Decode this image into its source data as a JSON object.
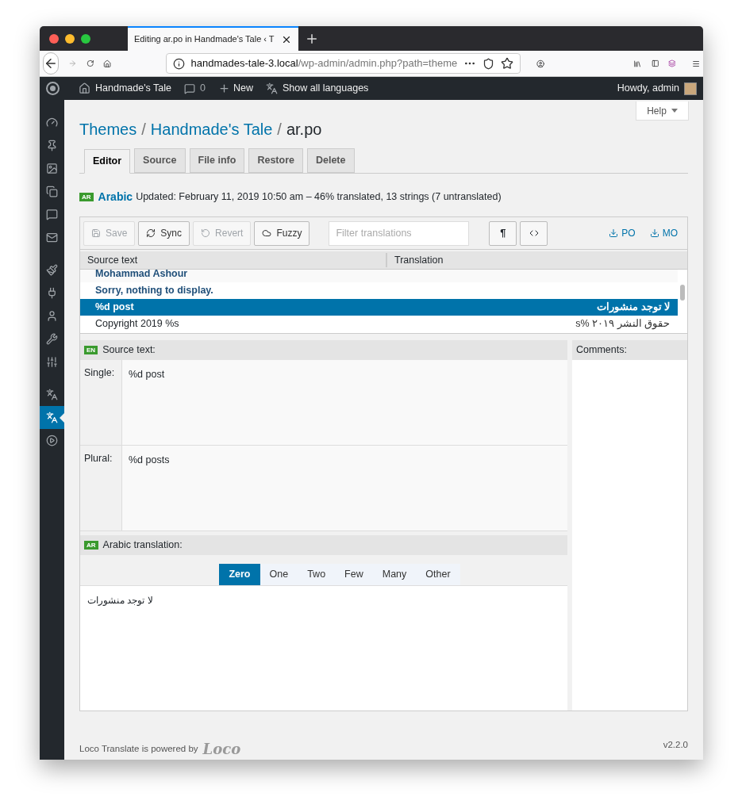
{
  "browser": {
    "tab_title": "Editing ar.po in Handmade's Tale ‹ T",
    "url_host": "handmades-tale-3.local",
    "url_path": "/wp-admin/admin.php?path=theme"
  },
  "admin_bar": {
    "site_name": "Handmade's Tale",
    "comments_count": "0",
    "new_label": "New",
    "languages_label": "Show all languages",
    "greeting": "Howdy, admin"
  },
  "sidebar": {
    "items": [
      {
        "kind": "dashboard",
        "selected": false
      },
      {
        "kind": "posts",
        "selected": false
      },
      {
        "kind": "media",
        "selected": false
      },
      {
        "kind": "pages",
        "selected": false
      },
      {
        "kind": "comments",
        "selected": false
      },
      {
        "kind": "mail",
        "selected": false
      },
      {
        "kind": "appearance",
        "selected": false
      },
      {
        "kind": "plugins",
        "selected": false
      },
      {
        "kind": "users",
        "selected": false
      },
      {
        "kind": "tools",
        "selected": false
      },
      {
        "kind": "settings",
        "selected": false
      },
      {
        "kind": "translate",
        "selected": false
      },
      {
        "kind": "translate",
        "selected": true
      },
      {
        "kind": "play",
        "selected": false
      }
    ]
  },
  "help_button": "Help",
  "breadcrumb": {
    "links": [
      "Themes",
      "Handmade's Tale"
    ],
    "separators": [
      "/",
      "/"
    ],
    "current": "ar.po"
  },
  "tabs": [
    {
      "label": "Editor",
      "selected": true
    },
    {
      "label": "Source",
      "selected": false
    },
    {
      "label": "File info",
      "selected": false
    },
    {
      "label": "Restore",
      "selected": false
    },
    {
      "label": "Delete",
      "selected": false
    }
  ],
  "status": {
    "locale_code": "AR",
    "language": "Arabic",
    "summary": "Updated: February 11, 2019 10:50 am – 46% translated, 13 strings (7 untranslated)"
  },
  "toolbar": {
    "buttons": [
      {
        "kind": "save",
        "label": "Save",
        "disabled": true
      },
      {
        "kind": "sync",
        "label": "Sync",
        "disabled": false
      },
      {
        "kind": "revert",
        "label": "Revert",
        "disabled": true
      },
      {
        "kind": "fuzzy",
        "label": "Fuzzy",
        "disabled": false
      }
    ],
    "filter_placeholder": "Filter translations",
    "invisibles_toggle": "¶",
    "downloads": [
      "PO",
      "MO"
    ]
  },
  "table": {
    "columns": [
      "Source text",
      "Translation"
    ],
    "rows": [
      {
        "source": "Mohammad Ashour",
        "translation": "",
        "untranslated": true,
        "selected": false
      },
      {
        "source": "Sorry, nothing to display.",
        "translation": "",
        "untranslated": true,
        "selected": false
      },
      {
        "source": "%d post",
        "translation": "لا توجد منشورات",
        "untranslated": false,
        "selected": true
      },
      {
        "source": "Copyright 2019 %s",
        "translation": "حقوق النشر ٢٠١٩ %s",
        "untranslated": false,
        "selected": false
      }
    ]
  },
  "source_pane": {
    "locale_code": "EN",
    "label": "Source text:",
    "single_label": "Single:",
    "single": "%d post",
    "plural_label": "Plural:",
    "plural": "%d posts"
  },
  "comments_label": "Comments:",
  "translation_pane": {
    "locale_code": "AR",
    "label": "Arabic translation:",
    "plural_forms": [
      {
        "label": "Zero",
        "selected": true
      },
      {
        "label": "One",
        "selected": false
      },
      {
        "label": "Two",
        "selected": false
      },
      {
        "label": "Few",
        "selected": false
      },
      {
        "label": "Many",
        "selected": false
      },
      {
        "label": "Other",
        "selected": false
      }
    ],
    "value": "لا توجد منشورات"
  },
  "footer": {
    "text": "Loco Translate is powered by",
    "logo": "Loco",
    "version": "v2.2.0"
  }
}
